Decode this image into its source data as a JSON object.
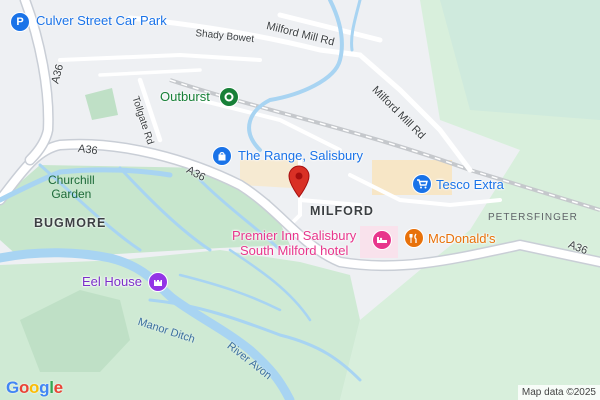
{
  "map": {
    "attribution": "Map data ©2025",
    "logo": {
      "letters": [
        "G",
        "o",
        "o",
        "g",
        "l",
        "e"
      ],
      "colors": [
        "#4285F4",
        "#EA4335",
        "#FBBC05",
        "#4285F4",
        "#34A853",
        "#EA4335"
      ]
    },
    "places": {
      "milford": "MILFORD",
      "bugmore": "BUGMORE",
      "petersfinger": "PETERSFINGER",
      "churchill_garden_line1": "Churchill",
      "churchill_garden_line2": "Garden"
    },
    "roads": {
      "milford_mill_rd_1": "Milford Mill Rd",
      "milford_mill_rd_2": "Milford Mill Rd",
      "shady_bower": "Shady Bowet",
      "tollgate_rd": "Tollgate Rd",
      "a36_north": "A36",
      "a36_west": "A36",
      "a36_middle": "A36",
      "a36_east": "A36"
    },
    "water": {
      "manor_ditch": "Manor Ditch",
      "river_avon": "River Avon"
    },
    "pois": {
      "culver_street_car_park": {
        "label": "Culver Street Car Park",
        "icon": "parking-icon",
        "color": "#1a73e8"
      },
      "outburst": {
        "label": "Outburst",
        "icon": "park-icon",
        "color": "#188038"
      },
      "the_range": {
        "label": "The Range, Salisbury",
        "icon": "shopping-bag-icon",
        "color": "#1a73e8"
      },
      "tesco_extra": {
        "label": "Tesco Extra",
        "icon": "shopping-cart-icon",
        "color": "#1a73e8"
      },
      "premier_inn_line1": {
        "label": "Premier Inn Salisbury",
        "icon": "hotel-bed-icon",
        "color": "#e8368c"
      },
      "premier_inn_line2": {
        "label": "South Milford hotel"
      },
      "mcdonalds": {
        "label": "McDonald's",
        "icon": "fork-knife-icon",
        "color": "#e8710a"
      },
      "eel_house": {
        "label": "Eel House",
        "icon": "castle-icon",
        "color": "#9334e6"
      }
    },
    "marker": {
      "icon": "location-pin-icon",
      "color": "#d93025"
    }
  }
}
